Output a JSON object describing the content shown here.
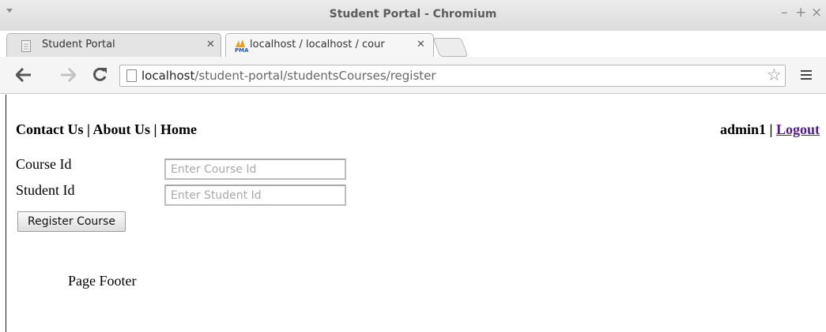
{
  "window": {
    "title": "Student Portal - Chromium",
    "controls": [
      "–",
      "+",
      "×"
    ]
  },
  "tabs": [
    {
      "label": "Student Portal",
      "active": false,
      "icon": "page-icon"
    },
    {
      "label": "localhost / localhost / cour",
      "active": true,
      "icon": "phpmyadmin-icon"
    }
  ],
  "toolbar": {
    "back": "🡐",
    "forward": "🡒",
    "reload": "C",
    "url_host": "localhost",
    "url_path": "/student-portal/studentsCourses/register",
    "bookmark": "☆"
  },
  "page": {
    "nav": {
      "contact": "Contact Us",
      "about": "About Us",
      "home": "Home",
      "separator": " | "
    },
    "user": {
      "name": "admin1",
      "separator": " | ",
      "logout": "Logout"
    },
    "form": {
      "course_label": "Course Id",
      "course_placeholder": "Enter Course Id",
      "student_label": "Student Id",
      "student_placeholder": "Enter Student Id",
      "submit_label": "Register Course"
    },
    "footer": "Page Footer"
  },
  "colors": {
    "visited_link": "#551a8b",
    "php_orange": "#e7a11a",
    "php_blue": "#1e5bb8"
  }
}
